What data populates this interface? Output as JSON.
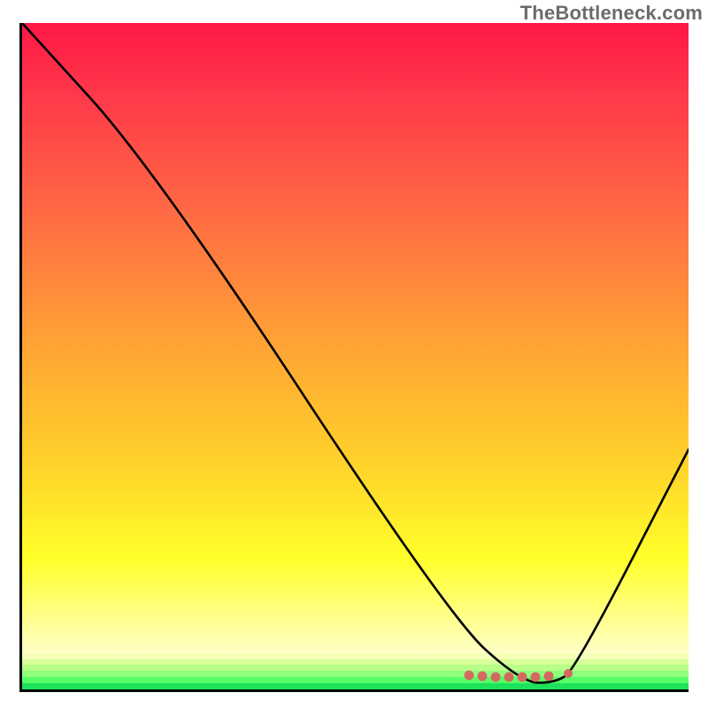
{
  "watermark": "TheBottleneck.com",
  "chart_data": {
    "type": "line",
    "title": "",
    "xlabel": "",
    "ylabel": "",
    "xlim": [
      0,
      100
    ],
    "ylim": [
      0,
      100
    ],
    "grid": false,
    "series": [
      {
        "name": "curve",
        "x": [
          0,
          20,
          64,
          75,
          80,
          83,
          100
        ],
        "y": [
          100,
          78,
          11,
          1,
          1,
          3,
          36
        ]
      }
    ],
    "markers": {
      "name": "optimal-range",
      "x": [
        67,
        69,
        71,
        73,
        75,
        77,
        79,
        82
      ],
      "y": [
        2.1,
        2.0,
        1.9,
        1.8,
        1.8,
        1.9,
        2.0,
        2.4
      ]
    },
    "colors": {
      "curve": "#000000",
      "marker": "#d46a5f",
      "gradient_top": "#ff1846",
      "gradient_bottom": "#1de25a"
    }
  }
}
